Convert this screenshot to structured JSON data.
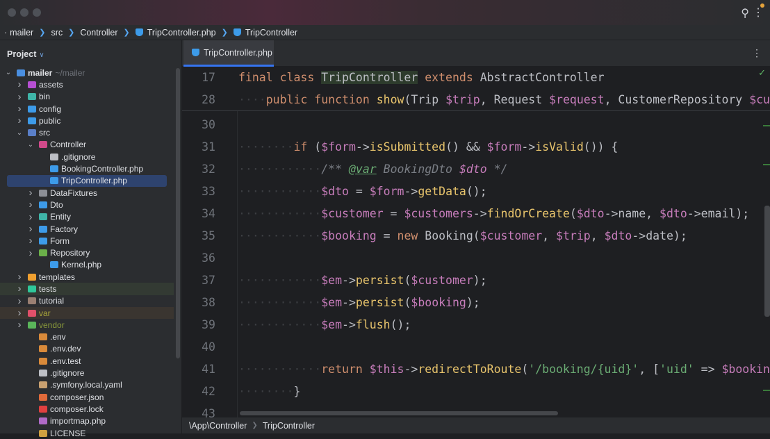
{
  "breadcrumb": [
    "mailer",
    "src",
    "Controller",
    "TripController.php",
    "TripController"
  ],
  "project": {
    "label": "Project"
  },
  "tree": [
    {
      "label": "mailer",
      "extra": "~/mailer",
      "depth": 0,
      "chev": "open",
      "color": "#4a8fe0"
    },
    {
      "label": "assets",
      "depth": 1,
      "chev": "closed",
      "color": "#b64fd2"
    },
    {
      "label": "bin",
      "depth": 1,
      "chev": "closed",
      "color": "#3fb5a8"
    },
    {
      "label": "config",
      "depth": 1,
      "chev": "closed",
      "color": "#3d9be9"
    },
    {
      "label": "public",
      "depth": 1,
      "chev": "closed",
      "color": "#3d9be9"
    },
    {
      "label": "src",
      "depth": 1,
      "chev": "open",
      "color": "#5a7fc8"
    },
    {
      "label": "Controller",
      "depth": 2,
      "chev": "open",
      "color": "#d04a8a"
    },
    {
      "label": ".gitignore",
      "depth": 3,
      "color": "#bcbec4"
    },
    {
      "label": "BookingController.php",
      "depth": 3,
      "color": "#3d9be9"
    },
    {
      "label": "TripController.php",
      "depth": 3,
      "color": "#3d9be9",
      "selected": true
    },
    {
      "label": "DataFixtures",
      "depth": 2,
      "chev": "closed",
      "color": "#8c8f96"
    },
    {
      "label": "Dto",
      "depth": 2,
      "chev": "closed",
      "color": "#3d9be9"
    },
    {
      "label": "Entity",
      "depth": 2,
      "chev": "closed",
      "color": "#3fb5a8"
    },
    {
      "label": "Factory",
      "depth": 2,
      "chev": "closed",
      "color": "#3d9be9"
    },
    {
      "label": "Form",
      "depth": 2,
      "chev": "closed",
      "color": "#3d9be9"
    },
    {
      "label": "Repository",
      "depth": 2,
      "chev": "closed",
      "color": "#6bb04a"
    },
    {
      "label": "Kernel.php",
      "depth": 3,
      "color": "#3d9be9"
    },
    {
      "label": "templates",
      "depth": 1,
      "chev": "closed",
      "color": "#f0a030"
    },
    {
      "label": "tests",
      "depth": 1,
      "chev": "closed",
      "color": "#2fc79a",
      "bg": "g"
    },
    {
      "label": "tutorial",
      "depth": 1,
      "chev": "closed",
      "color": "#9a7f72"
    },
    {
      "label": "var",
      "depth": 1,
      "chev": "closed",
      "color": "#e0506a",
      "bg": "y",
      "text": "#a9a63a"
    },
    {
      "label": "vendor",
      "depth": 1,
      "chev": "closed",
      "color": "#5ab55a",
      "text": "#8a9a3a"
    },
    {
      "label": ".env",
      "depth": 2,
      "color": "#d98a3a"
    },
    {
      "label": ".env.dev",
      "depth": 2,
      "color": "#d98a3a"
    },
    {
      "label": ".env.test",
      "depth": 2,
      "color": "#d98a3a"
    },
    {
      "label": ".gitignore",
      "depth": 2,
      "color": "#bcbec4"
    },
    {
      "label": ".symfony.local.yaml",
      "depth": 2,
      "color": "#c8a070"
    },
    {
      "label": "composer.json",
      "depth": 2,
      "color": "#e06a3a"
    },
    {
      "label": "composer.lock",
      "depth": 2,
      "color": "#e04040"
    },
    {
      "label": "importmap.php",
      "depth": 2,
      "color": "#b06ac8"
    },
    {
      "label": "LICENSE",
      "depth": 2,
      "color": "#d0a040"
    }
  ],
  "tab": {
    "label": "TripController.php"
  },
  "sticky": [
    {
      "n": "17",
      "t": [
        [
          "final class ",
          "kw"
        ],
        [
          "TripController",
          "hl"
        ],
        [
          " extends ",
          "kw"
        ],
        [
          "AbstractController",
          ""
        ]
      ]
    },
    {
      "n": "28",
      "t": [
        [
          "····",
          "ws"
        ],
        [
          "public function ",
          "kw"
        ],
        [
          "show",
          "fn"
        ],
        [
          "(Trip ",
          ""
        ],
        [
          "$trip",
          "v"
        ],
        [
          ", Request ",
          ""
        ],
        [
          "$request",
          "v"
        ],
        [
          ", CustomerRepository ",
          ""
        ],
        [
          "$cus",
          "v"
        ]
      ]
    }
  ],
  "lines": [
    {
      "n": "30",
      "t": []
    },
    {
      "n": "31",
      "t": [
        [
          "········",
          "ws"
        ],
        [
          "if ",
          "kw"
        ],
        [
          "(",
          ""
        ],
        [
          "$form",
          "v"
        ],
        [
          "->",
          ""
        ],
        [
          "isSubmitted",
          "fn"
        ],
        [
          "() && ",
          ""
        ],
        [
          "$form",
          "v"
        ],
        [
          "->",
          ""
        ],
        [
          "isValid",
          "fn"
        ],
        [
          "()) {",
          ""
        ]
      ]
    },
    {
      "n": "32",
      "t": [
        [
          "············",
          "ws"
        ],
        [
          "/** ",
          "dc"
        ],
        [
          "@var",
          "dt"
        ],
        [
          " BookingDto ",
          "dc"
        ],
        [
          "$dto",
          "dv"
        ],
        [
          " */",
          "dc"
        ]
      ]
    },
    {
      "n": "33",
      "t": [
        [
          "············",
          "ws"
        ],
        [
          "$dto",
          "v"
        ],
        [
          " = ",
          ""
        ],
        [
          "$form",
          "v"
        ],
        [
          "->",
          ""
        ],
        [
          "getData",
          "fn"
        ],
        [
          "();",
          ""
        ]
      ]
    },
    {
      "n": "34",
      "t": [
        [
          "············",
          "ws"
        ],
        [
          "$customer",
          "v"
        ],
        [
          " = ",
          ""
        ],
        [
          "$customers",
          "v"
        ],
        [
          "->",
          ""
        ],
        [
          "findOrCreate",
          "fn"
        ],
        [
          "(",
          ""
        ],
        [
          "$dto",
          "v"
        ],
        [
          "->name, ",
          ""
        ],
        [
          "$dto",
          "v"
        ],
        [
          "->email);",
          ""
        ]
      ]
    },
    {
      "n": "35",
      "t": [
        [
          "············",
          "ws"
        ],
        [
          "$booking",
          "v"
        ],
        [
          " = ",
          ""
        ],
        [
          "new ",
          "kw"
        ],
        [
          "Booking(",
          ""
        ],
        [
          "$customer",
          "v"
        ],
        [
          ", ",
          ""
        ],
        [
          "$trip",
          "v"
        ],
        [
          ", ",
          ""
        ],
        [
          "$dto",
          "v"
        ],
        [
          "->date);",
          ""
        ]
      ]
    },
    {
      "n": "36",
      "t": []
    },
    {
      "n": "37",
      "t": [
        [
          "············",
          "ws"
        ],
        [
          "$em",
          "v"
        ],
        [
          "->",
          ""
        ],
        [
          "persist",
          "fn"
        ],
        [
          "(",
          ""
        ],
        [
          "$customer",
          "v"
        ],
        [
          ");",
          ""
        ]
      ]
    },
    {
      "n": "38",
      "t": [
        [
          "············",
          "ws"
        ],
        [
          "$em",
          "v"
        ],
        [
          "->",
          ""
        ],
        [
          "persist",
          "fn"
        ],
        [
          "(",
          ""
        ],
        [
          "$booking",
          "v"
        ],
        [
          ");",
          ""
        ]
      ]
    },
    {
      "n": "39",
      "t": [
        [
          "············",
          "ws"
        ],
        [
          "$em",
          "v"
        ],
        [
          "->",
          ""
        ],
        [
          "flush",
          "fn"
        ],
        [
          "();",
          ""
        ]
      ]
    },
    {
      "n": "40",
      "t": []
    },
    {
      "n": "41",
      "t": [
        [
          "············",
          "ws"
        ],
        [
          "return ",
          "kw"
        ],
        [
          "$this",
          "v"
        ],
        [
          "->",
          ""
        ],
        [
          "redirectToRoute",
          "fn"
        ],
        [
          "(",
          ""
        ],
        [
          "'/booking/{uid}'",
          "s"
        ],
        [
          ", [",
          ""
        ],
        [
          "'uid'",
          "s"
        ],
        [
          " => ",
          ""
        ],
        [
          "$bookin",
          "v"
        ]
      ]
    },
    {
      "n": "42",
      "t": [
        [
          "········",
          "ws"
        ],
        [
          "}",
          ""
        ]
      ]
    },
    {
      "n": "43",
      "t": []
    }
  ],
  "status": [
    "\\App\\Controller",
    "TripController"
  ]
}
